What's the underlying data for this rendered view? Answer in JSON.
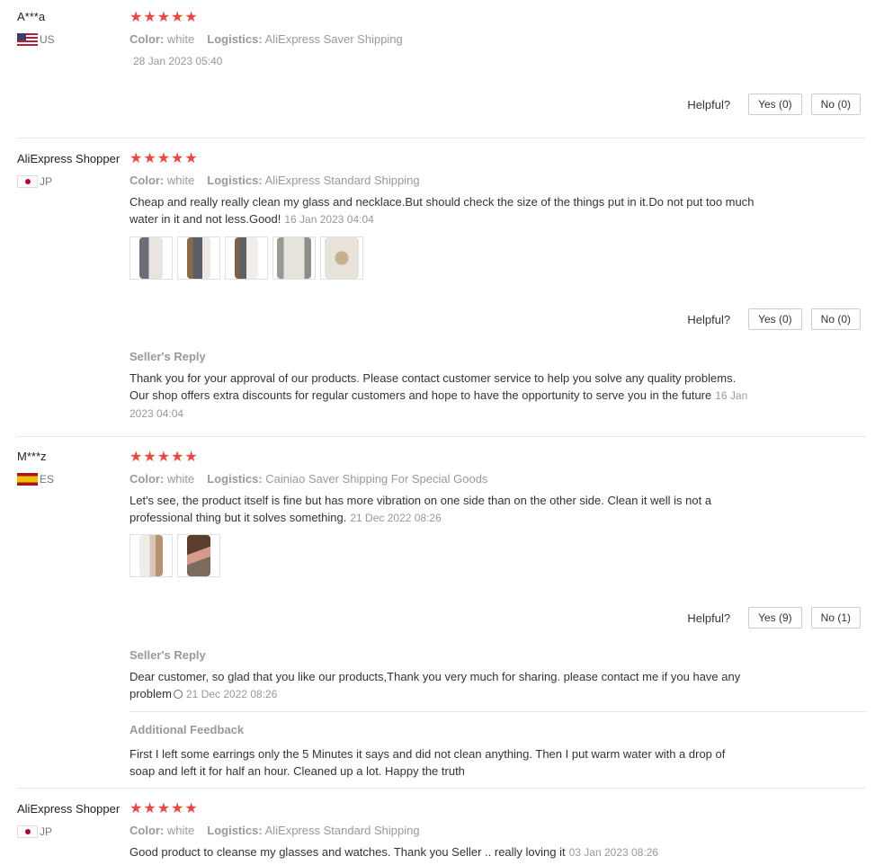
{
  "stars": "★★★★★",
  "helpful_label": "Helpful?",
  "labels": {
    "color": "Color:",
    "logistics": "Logistics:",
    "seller_reply": "Seller's Reply",
    "additional_feedback": "Additional Feedback"
  },
  "reviews": [
    {
      "user": "A***a",
      "country": "US",
      "color": "white",
      "logistics": "AliExpress Saver Shipping",
      "date": "28 Jan 2023 05:40",
      "yes": "Yes (0)",
      "no": "No (0)"
    },
    {
      "user": "AliExpress Shopper",
      "country": "JP",
      "color": "white",
      "logistics": "AliExpress Standard Shipping",
      "text": "Cheap and really really clean my glass and necklace.But should check the size of the things put in it.Do not put too much water in it and not less.Good!",
      "date": "16 Jan 2023 04:04",
      "yes": "Yes (0)",
      "no": "No (0)",
      "reply_text": "Thank you for your approval of our products. Please contact customer service to help you solve any quality problems. Our shop offers extra discounts for regular customers and hope to have the opportunity to serve you in the future",
      "reply_date": "16 Jan 2023 04:04"
    },
    {
      "user": "M***z",
      "country": "ES",
      "color": "white",
      "logistics": "Cainiao Saver Shipping For Special Goods",
      "text": "Let's see, the product itself is fine but has more vibration on one side than on the other side. Clean it well is not a professional thing but it solves something.",
      "date": "21 Dec 2022 08:26",
      "yes": "Yes (9)",
      "no": "No (1)",
      "reply_text": "Dear customer, so glad that you like our products,Thank you very much for sharing. please contact me if you have any problem",
      "reply_date": "21 Dec 2022 08:26",
      "additional_text": "First I left some earrings only the 5 Minutes it says and did not clean anything. Then I put warm water with a drop of soap and left it for half an hour. Cleaned up a lot. Happy the truth"
    },
    {
      "user": "AliExpress Shopper",
      "country": "JP",
      "color": "white",
      "logistics": "AliExpress Standard Shipping",
      "text": "Good product to cleanse my glasses and watches. Thank you Seller .. really loving it",
      "date": "03 Jan 2023 08:26"
    }
  ]
}
